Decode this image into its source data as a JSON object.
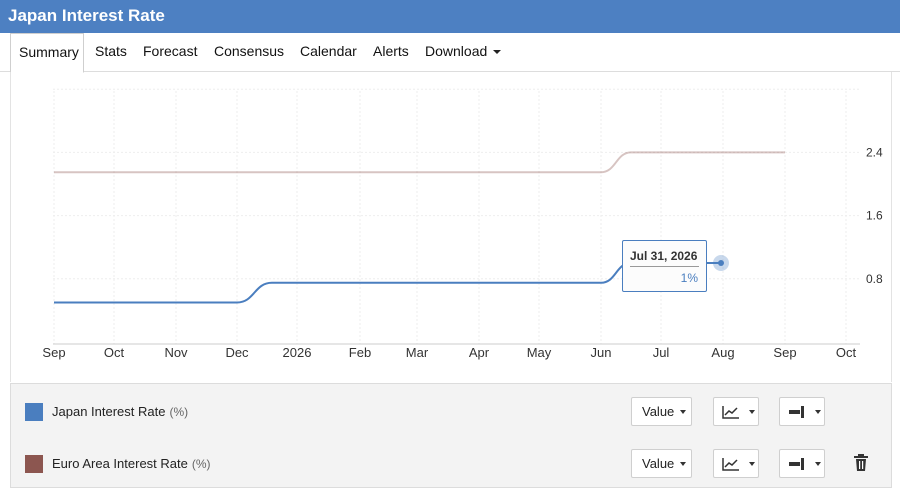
{
  "header": {
    "title": "Japan Interest Rate"
  },
  "tabs": [
    {
      "label": "Summary",
      "active": true
    },
    {
      "label": "Stats"
    },
    {
      "label": "Forecast"
    },
    {
      "label": "Consensus"
    },
    {
      "label": "Calendar"
    },
    {
      "label": "Alerts"
    },
    {
      "label": "Download",
      "has_dropdown": true
    }
  ],
  "chart_data": {
    "type": "line",
    "x_tick_labels": [
      "Sep",
      "Oct",
      "Nov",
      "Dec",
      "2026",
      "Feb",
      "Mar",
      "Apr",
      "May",
      "Jun",
      "Jul",
      "Aug",
      "Sep",
      "Oct"
    ],
    "y_tick_labels": [
      "2.4",
      "1.6",
      "0.8"
    ],
    "ylim": [
      0,
      3.2
    ],
    "y_axis_side": "right",
    "grid": true,
    "series": [
      {
        "name": "Japan Interest Rate",
        "color": "#4a7ebf",
        "points": [
          {
            "x": "2025-09-01",
            "y": 0.5
          },
          {
            "x": "2025-12-01",
            "y": 0.5
          },
          {
            "x": "2025-12-19",
            "y": 0.75
          },
          {
            "x": "2026-06-01",
            "y": 0.75
          },
          {
            "x": "2026-06-16",
            "y": 1.0
          },
          {
            "x": "2026-07-31",
            "y": 1.0
          }
        ]
      },
      {
        "name": "Euro Area Interest Rate",
        "color": "#8c5650",
        "points": [
          {
            "x": "2025-09-01",
            "y": 2.15
          },
          {
            "x": "2026-06-01",
            "y": 2.15
          },
          {
            "x": "2026-06-16",
            "y": 2.4
          },
          {
            "x": "2026-09-01",
            "y": 2.4
          }
        ]
      }
    ],
    "tooltip": {
      "date": "Jul 31, 2026",
      "value": "1%"
    }
  },
  "legend": [
    {
      "name": "Japan Interest Rate",
      "unit": "(%)",
      "color": "#4a7ebf",
      "value_label": "Value",
      "removable": false
    },
    {
      "name": "Euro Area Interest Rate",
      "unit": "(%)",
      "color": "#8c5650",
      "value_label": "Value",
      "removable": true
    }
  ],
  "icons": {
    "chart_type": "line-chart-icon",
    "axis": "axis-position-icon",
    "delete": "trash-icon",
    "dropdown": "chevron-down-icon"
  }
}
